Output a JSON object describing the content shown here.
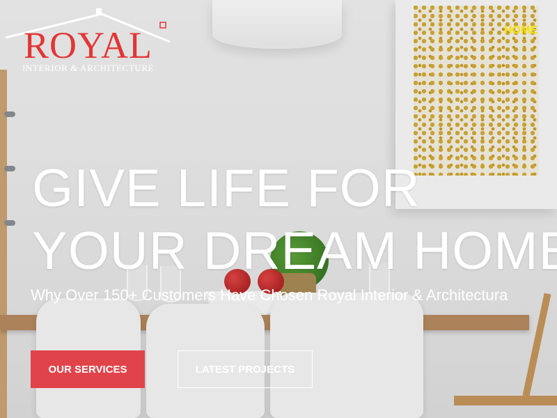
{
  "logo": {
    "word": "ROYAL",
    "subtitle": "INTERIOR & ARCHITECTURE",
    "accent_color": "#e33535"
  },
  "nav": {
    "items": [
      {
        "label": "HOME",
        "active": true,
        "color": "#f5e100"
      }
    ]
  },
  "hero": {
    "title_line1": "GIVE LIFE FOR",
    "title_line2": "YOUR DREAM HOME",
    "subtitle": "Why Over 150+ Customers Have Chosen Royal Interior & Architectura"
  },
  "buttons": {
    "services_label": "OUR SERVICES",
    "services_color": "#e1434a",
    "projects_label": "LATEST PROJECTS"
  },
  "background": {
    "description_icon": "dining-room-photo"
  }
}
